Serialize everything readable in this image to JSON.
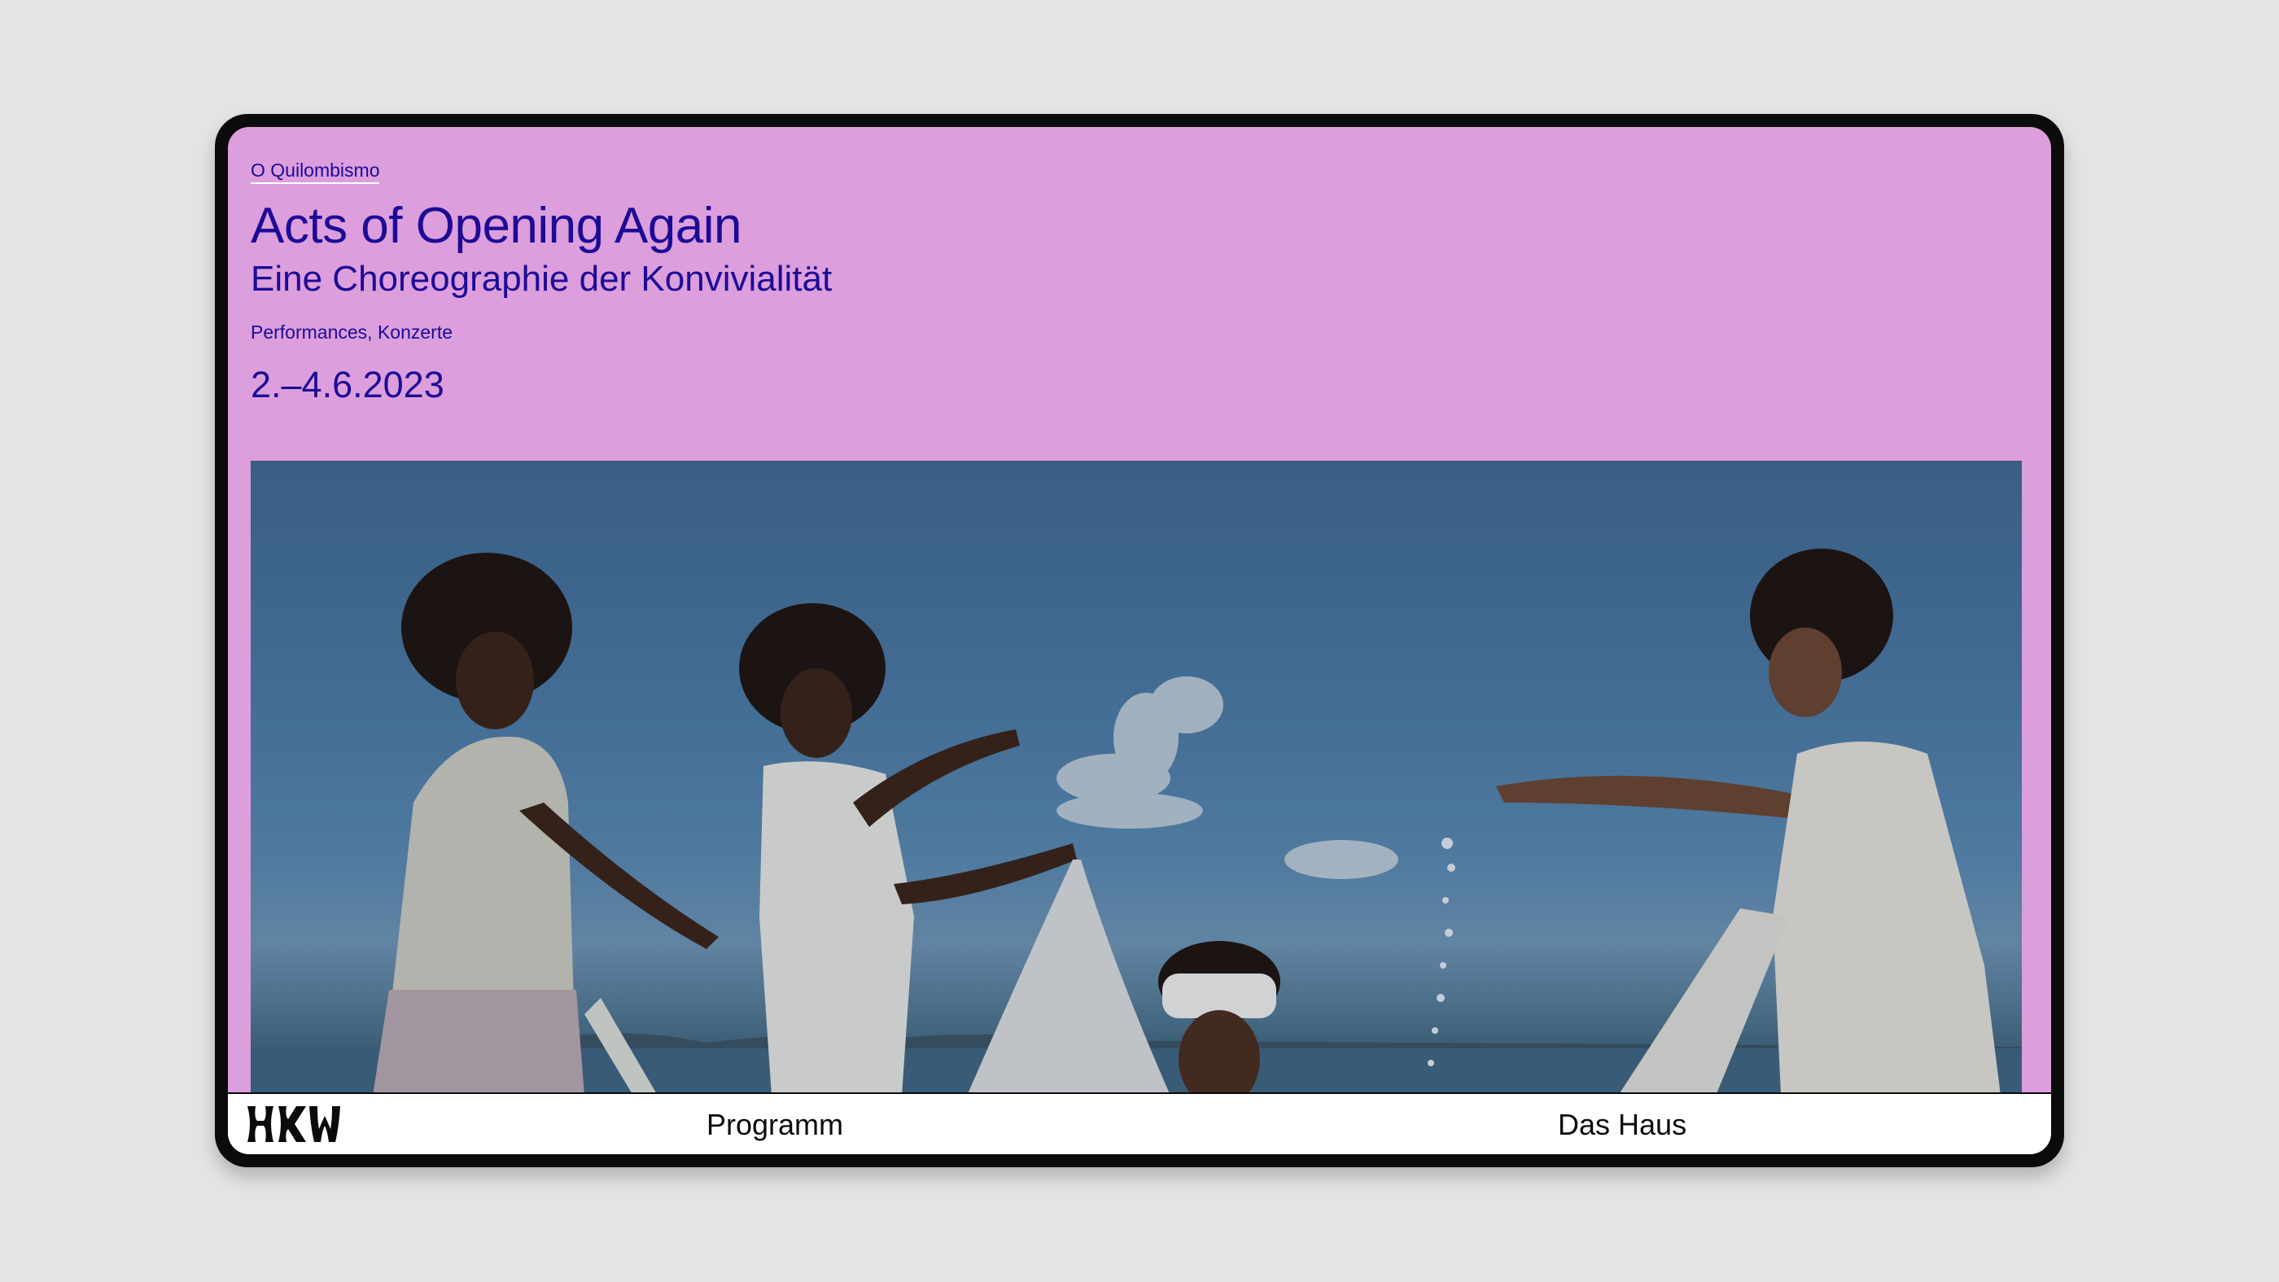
{
  "event": {
    "breadcrumb": "O Quilombismo",
    "title": "Acts of Opening Again",
    "subtitle": "Eine Choreographie der Konvivialität",
    "category": "Performances, Konzerte",
    "dates": "2.–4.6.2023"
  },
  "hero": {
    "icon": "beach-performance-photo"
  },
  "nav": {
    "logo": "HKW",
    "items": [
      {
        "label": "Programm"
      },
      {
        "label": "Das Haus"
      }
    ]
  },
  "colors": {
    "page_background": "#dc9edc",
    "text_primary": "#1d0b96",
    "frame": "#0b0b0b",
    "nav_background": "#ffffff",
    "outer_background": "#e4e4e4"
  }
}
